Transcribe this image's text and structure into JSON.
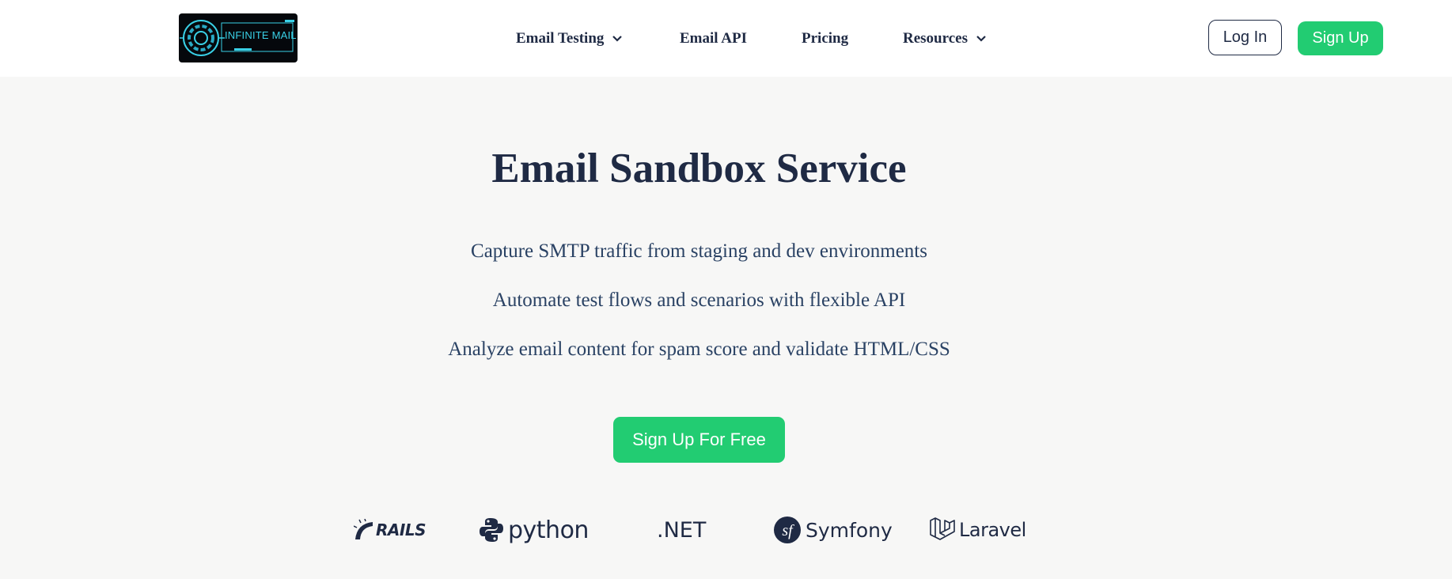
{
  "header": {
    "logo": {
      "text": "INFINITE MAIL",
      "icon": "infinite-mail-logo"
    },
    "nav": [
      {
        "label": "Email Testing",
        "has_dropdown": true
      },
      {
        "label": "Email API",
        "has_dropdown": false
      },
      {
        "label": "Pricing",
        "has_dropdown": false
      },
      {
        "label": "Resources",
        "has_dropdown": true
      }
    ],
    "login_label": "Log In",
    "signup_label": "Sign Up"
  },
  "hero": {
    "title": "Email Sandbox Service",
    "features": [
      "Capture SMTP traffic from staging and dev environments",
      "Automate test flows and scenarios with flexible API",
      "Analyze email content for spam score and validate HTML/CSS"
    ],
    "cta_label": "Sign Up For Free"
  },
  "frameworks": [
    {
      "name": "RAILS",
      "icon": "rails-logo"
    },
    {
      "name": "python",
      "icon": "python-logo"
    },
    {
      "name": ".NET",
      "icon": "dotnet-logo"
    },
    {
      "name": "Symfony",
      "icon": "symfony-logo"
    },
    {
      "name": "Laravel",
      "icon": "laravel-logo"
    }
  ],
  "colors": {
    "accent": "#22cc72",
    "text_dark": "#1f2a44",
    "text_body": "#2a4264",
    "background": "#f7f7f6",
    "logo_cyan": "#39d0e6"
  }
}
